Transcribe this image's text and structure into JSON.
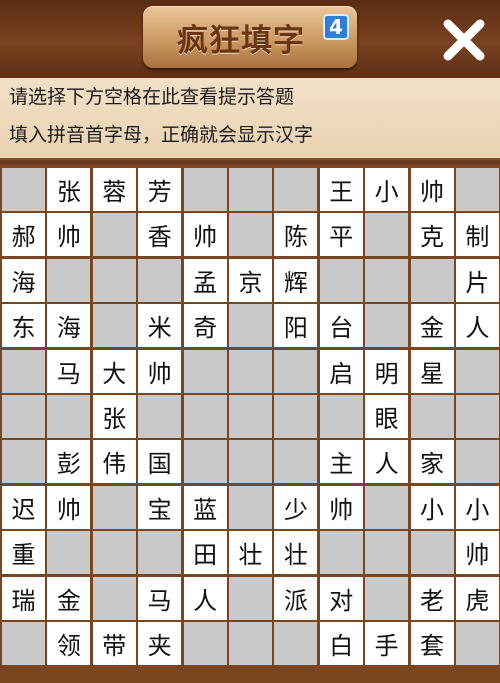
{
  "header": {
    "title": "疯狂填字",
    "level_badge": "4",
    "close_icon": "close-x-icon"
  },
  "hints": {
    "line1": "请选择下方空格在此查看提示答题",
    "line2": "填入拼音首字母，正确就会显示汉字"
  },
  "colors": {
    "blank_cell": "#c9c9c9",
    "white_cell": "#ffffff",
    "grid_line": "#7a4620",
    "badge": "#2f7fd6"
  },
  "grid": {
    "rows": [
      [
        "#",
        "张",
        "蓉",
        "芳",
        "#",
        "#",
        "#",
        "王",
        "小",
        "帅",
        "#"
      ],
      [
        "郝",
        "帅",
        "#",
        "香",
        "帅",
        "#",
        "陈",
        "平",
        "#",
        "克",
        "制"
      ],
      [
        "海",
        "#",
        "#",
        "#",
        "孟",
        "京",
        "辉",
        "#",
        "#",
        "#",
        "片"
      ],
      [
        "东",
        "海",
        "#",
        "米",
        "奇",
        "#",
        "阳",
        "台",
        "#",
        "金",
        "人"
      ],
      [
        "#",
        "马",
        "大",
        "帅",
        "#",
        "#",
        "#",
        "启",
        "明",
        "星",
        "#"
      ],
      [
        "#",
        "#",
        "张",
        "#",
        "#",
        "#",
        "#",
        "#",
        "眼",
        "#",
        "#"
      ],
      [
        "#",
        "彭",
        "伟",
        "国",
        "#",
        "#",
        "#",
        "主",
        "人",
        "家",
        "#"
      ],
      [
        "迟",
        "帅",
        "#",
        "宝",
        "蓝",
        "#",
        "少",
        "帅",
        "#",
        "小",
        "小"
      ],
      [
        "重",
        "#",
        "#",
        "#",
        "田",
        "壮",
        "壮",
        "#",
        "#",
        "#",
        "帅"
      ],
      [
        "瑞",
        "金",
        "#",
        "马",
        "人",
        "#",
        "派",
        "对",
        "#",
        "老",
        "虎"
      ],
      [
        "#",
        "领",
        "带",
        "夹",
        "#",
        "#",
        "#",
        "白",
        "手",
        "套",
        "#"
      ]
    ]
  }
}
